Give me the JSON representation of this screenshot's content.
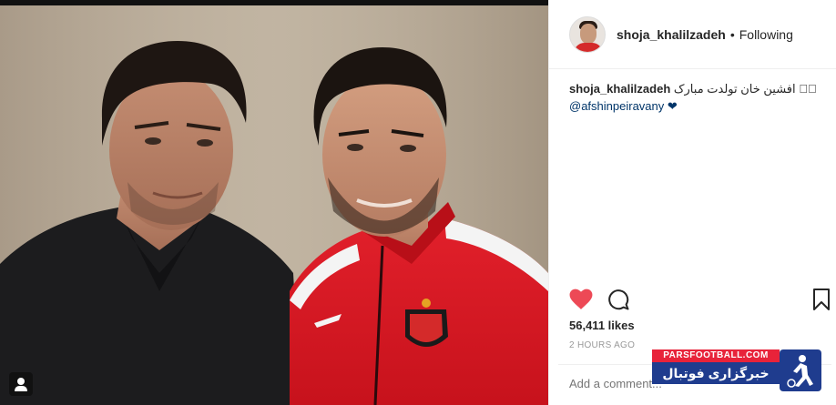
{
  "post": {
    "username": "shoja_khalilzadeh",
    "dot": "•",
    "follow_status": "Following",
    "caption_text": "افشین خان تولدت مبارک ❤",
    "caption_extra": "⃝",
    "mention": "@afshinpeiravany",
    "mention_suffix": " ❤",
    "likes": "56,411 likes",
    "time": "2 HOURS AGO",
    "comment_placeholder": "Add a comment..."
  },
  "watermark": {
    "top": "PARSFOOTBALL.COM",
    "bottom": "خبرگزاری فوتبال ایران"
  },
  "colors": {
    "like_red": "#ed4956",
    "watermark_red": "#e8233a",
    "watermark_blue": "#1f3c8e",
    "mention_blue": "#003569"
  },
  "icons": {
    "like": "heart-icon",
    "comment": "comment-icon",
    "save": "bookmark-icon",
    "user_tag": "user-tag-icon"
  }
}
